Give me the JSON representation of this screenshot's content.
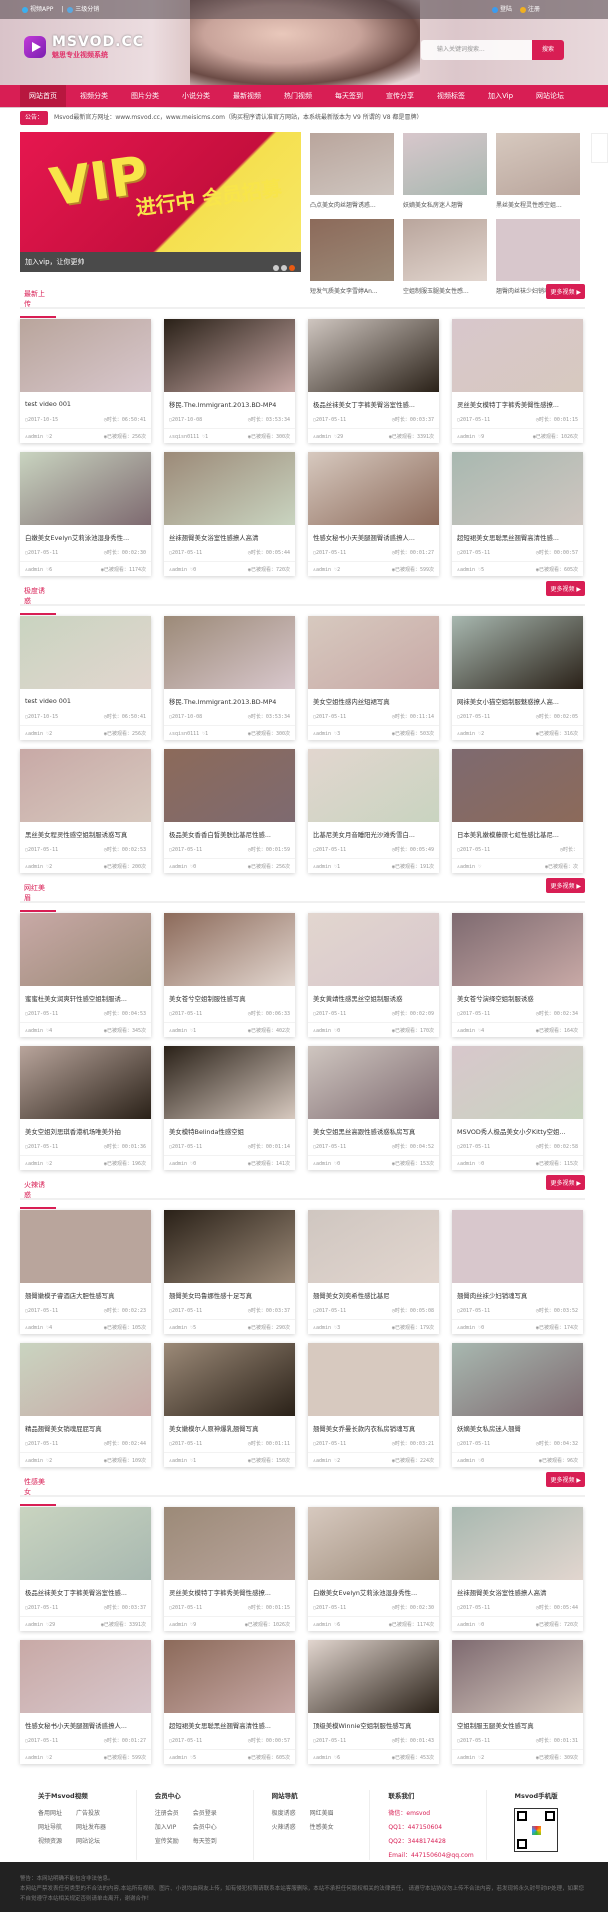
{
  "topbar": {
    "app": "视频APP",
    "distribution": "三级分销",
    "login": "登陆",
    "register": "注册"
  },
  "logo": {
    "name": "MSVOD.CC",
    "slogan": "魅思专业视频系统"
  },
  "search": {
    "placeholder": "输入关键词搜索...",
    "button": "搜索"
  },
  "nav": [
    "网站首页",
    "视频分类",
    "图片分类",
    "小说分类",
    "最新视频",
    "热门视频",
    "每天签到",
    "宣传分享",
    "视频标签",
    "加入Vip",
    "网站论坛"
  ],
  "notice": {
    "label": "公告：",
    "text": "Msvod最新官方网址：www.msvod.cc，www.meisicms.com（购买程序请认准官方网站，本系统最新版本为 V9  所谓的 V8 都是冒牌）"
  },
  "slider": {
    "vip": "VIP",
    "headline": "进行中 会员招募",
    "caption": "加入vip，让你更帅"
  },
  "thumbs": [
    "凸点美女肉丝翘臀诱惑...",
    "妖嫡美女私房迷人翘臀",
    "黑丝美女程灵性感空姐...",
    "短发气质美女李雪婷An...",
    "空姐制服玉腿美女性感...",
    "翘臀肉丝袜少妇销魂写真"
  ],
  "labels": {
    "more": "更多视频",
    "duration": "时长：",
    "views": "已被观看：",
    "times": "次"
  },
  "sections": [
    {
      "title": "最新上传",
      "items": [
        [
          "test video 001",
          "2017-10-15",
          "06:50:41",
          "admin",
          "2",
          "256"
        ],
        [
          "移民.The.Immigrant.2013.BD-MP4",
          "2017-10-08",
          "03:53:34",
          "sqisn0111",
          "1",
          "300"
        ],
        [
          "极品丝袜美女丁字裤美臀浴室性感...",
          "2017-05-11",
          "00:03:37",
          "admin",
          "29",
          "3391"
        ],
        [
          "灵丝美女模特丁字裤秀美臀性感撩...",
          "2017-05-11",
          "00:01:15",
          "admin",
          "9",
          "1026"
        ],
        [
          "白嫩美女Evelyn艾莉泳池湿身秀性...",
          "2017-05-11",
          "00:02:30",
          "admin",
          "6",
          "1174"
        ],
        [
          "丝袜翘臀美女浴室性感撩人高清",
          "2017-05-11",
          "00:05:44",
          "admin",
          "0",
          "720"
        ],
        [
          "性感女秘书小天美腿翘臀诱惑撩人...",
          "2017-05-11",
          "00:01:27",
          "admin",
          "2",
          "599"
        ],
        [
          "超短裙美女思聪黑丝翘臀高清性感...",
          "2017-05-11",
          "00:00:57",
          "admin",
          "5",
          "605"
        ]
      ]
    },
    {
      "title": "极度诱惑",
      "items": [
        [
          "test video 001",
          "2017-10-15",
          "06:50:41",
          "admin",
          "2",
          "256"
        ],
        [
          "移民.The.Immigrant.2013.BD-MP4",
          "2017-10-08",
          "03:53:34",
          "sqisn0111",
          "1",
          "300"
        ],
        [
          "美女空姐性感内丝短裙写真",
          "2017-05-11",
          "00:11:14",
          "admin",
          "3",
          "503"
        ],
        [
          "网袜美女小猫空姐制服魅惑撩人高...",
          "2017-05-11",
          "00:02:05",
          "admin",
          "2",
          "316"
        ],
        [
          "黑丝美女程灵性感空姐制服诱惑写真",
          "2017-05-11",
          "00:02:53",
          "admin",
          "2",
          "200"
        ],
        [
          "极品美女香香白皙美肤比基尼性感...",
          "2017-05-11",
          "00:01:59",
          "admin",
          "0",
          "256"
        ],
        [
          "比基尼美女月音睡阳光沙滩秀雪白...",
          "2017-05-11",
          "00:05:49",
          "admin",
          "1",
          "191"
        ],
        [
          "日本美乳嫩模藤原七虹性感比基尼...",
          "2017-05-11",
          "",
          "admin",
          "",
          ""
        ]
      ]
    },
    {
      "title": "网红美眉",
      "items": [
        [
          "蜜蜜杜美女润爽轩性感空姐制服诱...",
          "2017-05-11",
          "00:04:53",
          "admin",
          "4",
          "345"
        ],
        [
          "美女苍兮空姐制服性感写真",
          "2017-05-11",
          "00:06:33",
          "admin",
          "1",
          "402"
        ],
        [
          "美女黄靖性感黑丝空姐制服诱惑",
          "2017-05-11",
          "00:02:09",
          "admin",
          "0",
          "170"
        ],
        [
          "美女苍兮演绎空姐制服诱惑",
          "2017-05-11",
          "00:02:34",
          "admin",
          "4",
          "164"
        ],
        [
          "美女空姐刘思琪香港机场唯美外拍",
          "2017-05-11",
          "00:01:36",
          "admin",
          "2",
          "196"
        ],
        [
          "美女模特Belinda性感空姐",
          "2017-05-11",
          "00:01:14",
          "admin",
          "0",
          "141"
        ],
        [
          "美女空姐黑丝高跟性感诱惑私房写真",
          "2017-05-11",
          "00:04:52",
          "admin",
          "0",
          "153"
        ],
        [
          "MSVOD秀人极品美女小夕Kitty空姐...",
          "2017-05-11",
          "00:02:58",
          "admin",
          "0",
          "115"
        ]
      ]
    },
    {
      "title": "火辣诱惑",
      "items": [
        [
          "翘臀嫩模子睿酒店大胆性感写真",
          "2017-05-11",
          "00:02:23",
          "admin",
          "4",
          "105"
        ],
        [
          "翘臀美女玛鲁娜性感十足写真",
          "2017-05-11",
          "00:03:37",
          "admin",
          "5",
          "290"
        ],
        [
          "翘臀美女刘奕希性感比基尼",
          "2017-05-11",
          "00:05:08",
          "admin",
          "3",
          "179"
        ],
        [
          "翘臀肉丝袜少妇销魂写真",
          "2017-05-11",
          "00:03:52",
          "admin",
          "0",
          "174"
        ],
        [
          "精品翘臀美女销魂屁屁写真",
          "2017-05-11",
          "00:02:44",
          "admin",
          "2",
          "109"
        ],
        [
          "美女嫩模尔人原神爆乳翘臀写真",
          "2017-05-11",
          "00:01:11",
          "admin",
          "1",
          "150"
        ],
        [
          "翘臀美女乔曼长款内衣私房销魂写真",
          "2017-05-11",
          "00:03:21",
          "admin",
          "2",
          "224"
        ],
        [
          "妖嫡美女私房迷人翘臀",
          "2017-05-11",
          "00:04:32",
          "admin",
          "0",
          "96"
        ]
      ]
    },
    {
      "title": "性感美女",
      "items": [
        [
          "极品丝袜美女丁字裤美臀浴室性感...",
          "2017-05-11",
          "00:03:37",
          "admin",
          "29",
          "3391"
        ],
        [
          "灵丝美女模特丁字裤秀美臀性感撩...",
          "2017-05-11",
          "00:01:15",
          "admin",
          "9",
          "1026"
        ],
        [
          "白嫩美女Evelyn艾莉泳池湿身秀性...",
          "2017-05-11",
          "00:02:30",
          "admin",
          "6",
          "1174"
        ],
        [
          "丝袜翘臀美女浴室性感撩人高清",
          "2017-05-11",
          "00:05:44",
          "admin",
          "0",
          "720"
        ],
        [
          "性感女秘书小天美腿翘臀诱惑撩人...",
          "2017-05-11",
          "00:01:27",
          "admin",
          "2",
          "599"
        ],
        [
          "超短裙美女思聪黑丝翘臀高清性感...",
          "2017-05-11",
          "00:00:57",
          "admin",
          "5",
          "605"
        ],
        [
          "顶级美模Winnie空姐制服性感写真",
          "2017-05-11",
          "00:01:43",
          "admin",
          "6",
          "453"
        ],
        [
          "空姐制服玉腿美女性感写真",
          "2017-05-11",
          "00:01:31",
          "admin",
          "2",
          "309"
        ]
      ]
    }
  ],
  "footer": {
    "about": {
      "title": "关于Msvod视频",
      "links": [
        "备用网址",
        "广告投放",
        "网址导航",
        "网址发布器",
        "视频资源",
        "网站论坛"
      ]
    },
    "member": {
      "title": "会员中心",
      "links": [
        "注册会员",
        "会员登录",
        "加入VIP",
        "会员中心",
        "宣传奖励",
        "每天签到"
      ]
    },
    "sitenav": {
      "title": "网站导航",
      "links": [
        "极度诱惑",
        "网红美眉",
        "火辣诱惑",
        "性感美女"
      ]
    },
    "contact": {
      "title": "联系我们",
      "lines": [
        "微信：emsvod",
        "QQ1：447150604",
        "QQ2：3448174428",
        "Email：447150604@qq.com"
      ]
    },
    "mobile": {
      "title": "Msvod手机版"
    },
    "warning": "警告：本网站明确不能包含非法信息。",
    "disclaimer": "本网站严禁发表任何类型的不合法的内容,本站所有视频、图片、小说均由网友上传，如有侵犯权限请联系本站客服删除，本站不承担任何版权相关的法律责任， 请遵守本站协议勿上传不合法内容，若发现将永久封号封IP处理，如果您不自觉遵守本站相关规定否则请单击离开，谢谢合作！"
  },
  "colors": {
    "accent": "#d81e54",
    "dark": "#222222"
  }
}
